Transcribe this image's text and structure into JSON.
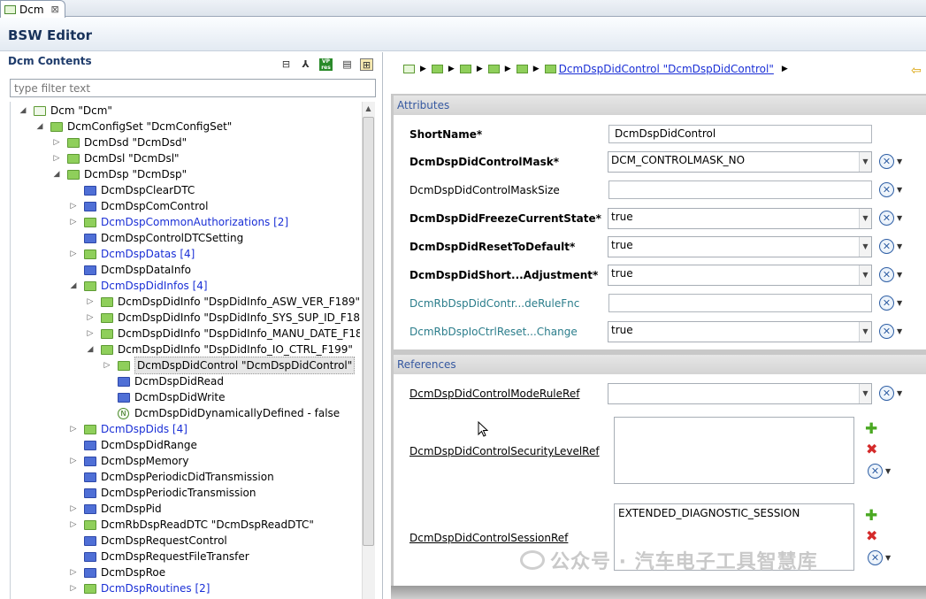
{
  "tab": {
    "label": "Dcm",
    "close": "⊠"
  },
  "editor": {
    "title": "BSW Editor"
  },
  "left_panel": {
    "title": "Dcm Contents",
    "toolbar_icons": [
      "collapse-all-icon",
      "hierarchy-icon",
      "vp-res-icon",
      "document-icon",
      "layout-icon"
    ],
    "vp_label": "VP\nres",
    "filter_placeholder": "type filter text"
  },
  "tree": [
    {
      "indent": 0,
      "twisty": "◢",
      "icon": "w",
      "text": "Dcm \"Dcm\"",
      "style": ""
    },
    {
      "indent": 1,
      "twisty": "◢",
      "icon": "g",
      "text": "DcmConfigSet \"DcmConfigSet\"",
      "style": ""
    },
    {
      "indent": 2,
      "twisty": "▷",
      "icon": "g",
      "text": "DcmDsd \"DcmDsd\"",
      "style": ""
    },
    {
      "indent": 2,
      "twisty": "▷",
      "icon": "g",
      "text": "DcmDsl \"DcmDsl\"",
      "style": ""
    },
    {
      "indent": 2,
      "twisty": "◢",
      "icon": "g",
      "text": "DcmDsp \"DcmDsp\"",
      "style": ""
    },
    {
      "indent": 3,
      "twisty": "",
      "icon": "b",
      "text": "DcmDspClearDTC",
      "style": ""
    },
    {
      "indent": 3,
      "twisty": "▷",
      "icon": "b",
      "text": "DcmDspComControl",
      "style": ""
    },
    {
      "indent": 3,
      "twisty": "▷",
      "icon": "g",
      "text": "DcmDspCommonAuthorizations [2]",
      "style": "blue"
    },
    {
      "indent": 3,
      "twisty": "",
      "icon": "b",
      "text": "DcmDspControlDTCSetting",
      "style": ""
    },
    {
      "indent": 3,
      "twisty": "▷",
      "icon": "g",
      "text": "DcmDspDatas [4]",
      "style": "blue"
    },
    {
      "indent": 3,
      "twisty": "",
      "icon": "b",
      "text": "DcmDspDataInfo",
      "style": ""
    },
    {
      "indent": 3,
      "twisty": "◢",
      "icon": "g",
      "text": "DcmDspDidInfos [4]",
      "style": "blue"
    },
    {
      "indent": 4,
      "twisty": "▷",
      "icon": "g",
      "text": "DcmDspDidInfo \"DspDidInfo_ASW_VER_F189\"",
      "style": ""
    },
    {
      "indent": 4,
      "twisty": "▷",
      "icon": "g",
      "text": "DcmDspDidInfo \"DspDidInfo_SYS_SUP_ID_F18A\"",
      "style": ""
    },
    {
      "indent": 4,
      "twisty": "▷",
      "icon": "g",
      "text": "DcmDspDidInfo \"DspDidInfo_MANU_DATE_F18B\"",
      "style": ""
    },
    {
      "indent": 4,
      "twisty": "◢",
      "icon": "g",
      "text": "DcmDspDidInfo \"DspDidInfo_IO_CTRL_F199\"",
      "style": ""
    },
    {
      "indent": 5,
      "twisty": "▷",
      "icon": "g",
      "text": "DcmDspDidControl \"DcmDspDidControl\"",
      "style": "sel"
    },
    {
      "indent": 5,
      "twisty": "",
      "icon": "b",
      "text": "DcmDspDidRead",
      "style": ""
    },
    {
      "indent": 5,
      "twisty": "",
      "icon": "b",
      "text": "DcmDspDidWrite",
      "style": ""
    },
    {
      "indent": 5,
      "twisty": "",
      "icon": "n",
      "text": "DcmDspDidDynamicallyDefined - false",
      "style": ""
    },
    {
      "indent": 3,
      "twisty": "▷",
      "icon": "g",
      "text": "DcmDspDids [4]",
      "style": "blue"
    },
    {
      "indent": 3,
      "twisty": "",
      "icon": "b",
      "text": "DcmDspDidRange",
      "style": ""
    },
    {
      "indent": 3,
      "twisty": "▷",
      "icon": "b",
      "text": "DcmDspMemory",
      "style": ""
    },
    {
      "indent": 3,
      "twisty": "",
      "icon": "b",
      "text": "DcmDspPeriodicDidTransmission",
      "style": ""
    },
    {
      "indent": 3,
      "twisty": "",
      "icon": "b",
      "text": "DcmDspPeriodicTransmission",
      "style": ""
    },
    {
      "indent": 3,
      "twisty": "▷",
      "icon": "b",
      "text": "DcmDspPid",
      "style": ""
    },
    {
      "indent": 3,
      "twisty": "▷",
      "icon": "g",
      "text": "DcmRbDspReadDTC \"DcmDspReadDTC\"",
      "style": ""
    },
    {
      "indent": 3,
      "twisty": "",
      "icon": "b",
      "text": "DcmDspRequestControl",
      "style": ""
    },
    {
      "indent": 3,
      "twisty": "",
      "icon": "b",
      "text": "DcmDspRequestFileTransfer",
      "style": ""
    },
    {
      "indent": 3,
      "twisty": "▷",
      "icon": "b",
      "text": "DcmDspRoe",
      "style": ""
    },
    {
      "indent": 3,
      "twisty": "▷",
      "icon": "g",
      "text": "DcmDspRoutines [2]",
      "style": "blue"
    }
  ],
  "breadcrumb": {
    "current": "DcmDspDidControl \"DcmDspDidControl\""
  },
  "attributes": {
    "header": "Attributes",
    "short_name": {
      "label": "ShortName*",
      "value": "DcmDspDidControl"
    },
    "mask": {
      "label": "DcmDspDidControlMask*",
      "value": "DCM_CONTROLMASK_NO"
    },
    "mask_size": {
      "label": "DcmDspDidControlMaskSize",
      "value": ""
    },
    "freeze": {
      "label": "DcmDspDidFreezeCurrentState*",
      "value": "true"
    },
    "reset": {
      "label": "DcmDspDidResetToDefault*",
      "value": "true"
    },
    "short_adj": {
      "label": "DcmDspDidShort...Adjustment*",
      "value": "true"
    },
    "rb_rule": {
      "label": "DcmRbDspDidContr...deRuleFnc",
      "value": ""
    },
    "rb_ioctrl": {
      "label": "DcmRbDspIoCtrlReset...Change",
      "value": "true"
    }
  },
  "references": {
    "header": "References",
    "mode_rule": {
      "label": "DcmDspDidControlModeRuleRef",
      "value": ""
    },
    "security": {
      "label": "DcmDspDidControlSecurityLevelRef",
      "items": []
    },
    "session": {
      "label": "DcmDspDidControlSessionRef",
      "items": [
        "EXTENDED_DIAGNOSTIC_SESSION"
      ]
    }
  },
  "watermark": {
    "text": "公众号 · 汽车电子工具智慧库"
  }
}
